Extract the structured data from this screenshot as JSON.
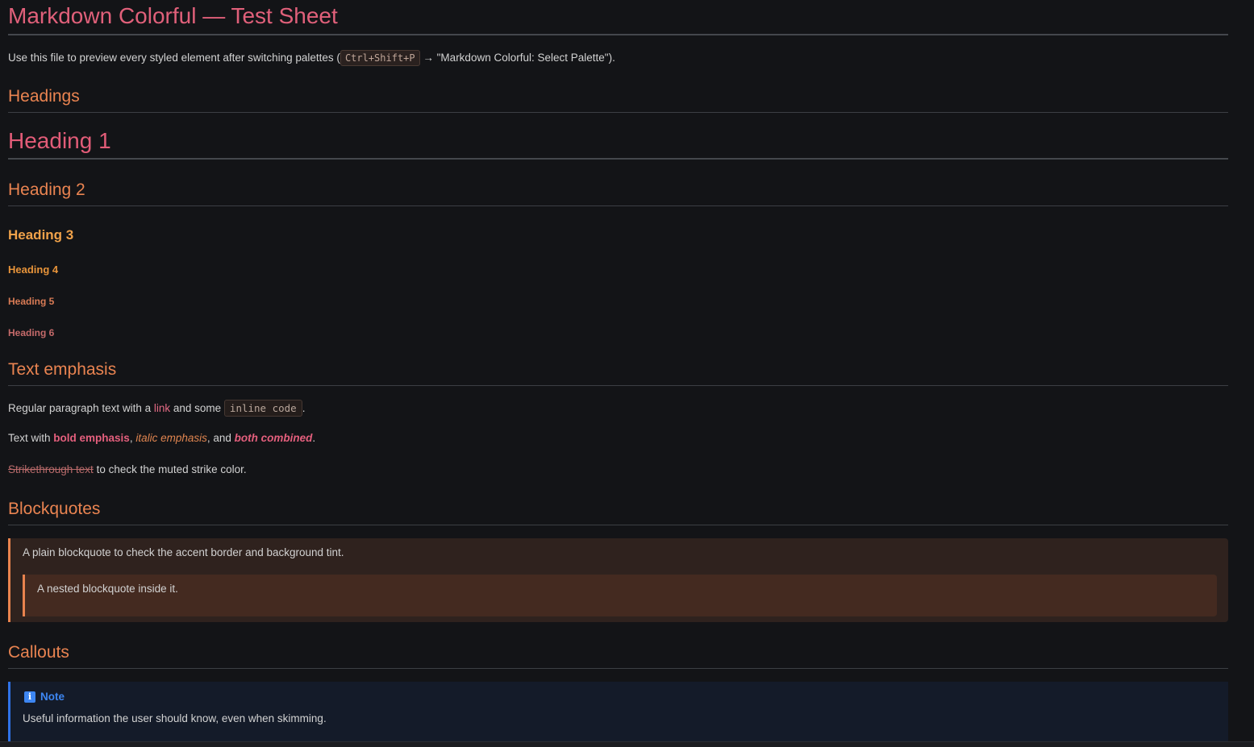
{
  "title": "Markdown Colorful — Test Sheet",
  "intro": {
    "before": "Use this file to preview every styled element after switching palettes (",
    "kbd": "Ctrl+Shift+P",
    "after": " → \"Markdown Colorful: Select Palette\")."
  },
  "sections": {
    "headings": "Headings",
    "text_emphasis": "Text emphasis",
    "blockquotes": "Blockquotes",
    "callouts": "Callouts"
  },
  "headings": {
    "h1": "Heading 1",
    "h2": "Heading 2",
    "h3": "Heading 3",
    "h4": "Heading 4",
    "h5": "Heading 5",
    "h6": "Heading 6"
  },
  "emphasis": {
    "p1_before": "Regular paragraph text with a ",
    "p1_link": "link",
    "p1_middle": " and some ",
    "p1_code": "inline code",
    "p1_after": ".",
    "p2_before": "Text with ",
    "p2_bold": "bold emphasis",
    "p2_sep1": ", ",
    "p2_italic": "italic emphasis",
    "p2_sep2": ", and ",
    "p2_both": "both combined",
    "p2_after": ".",
    "p3_strike": "Strikethrough text",
    "p3_after": " to check the muted strike color."
  },
  "blockquote": {
    "outer": "A plain blockquote to check the accent border and background tint.",
    "nested": "A nested blockquote inside it."
  },
  "callout": {
    "icon": "info-icon",
    "title": "Note",
    "body": "Useful information the user should know, even when skimming."
  },
  "colors": {
    "background": "#131417",
    "h1": "#e25c78",
    "h2": "#ea8451",
    "h3": "#f0a24a",
    "link": "#e36a84",
    "blockquote_border": "#e8834e",
    "note_accent": "#3d86f2"
  }
}
